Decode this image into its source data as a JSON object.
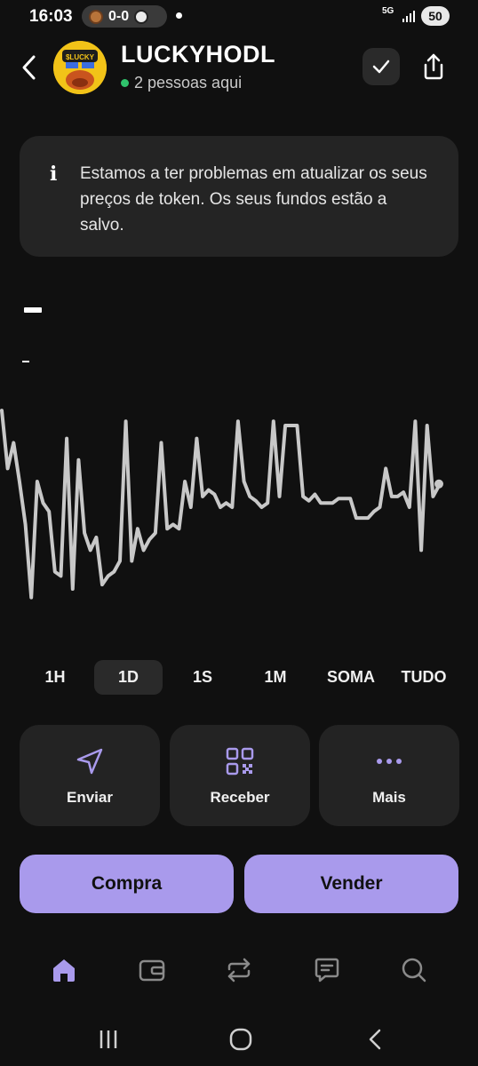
{
  "status_bar": {
    "time": "16:03",
    "score": "0-0",
    "network": "5G",
    "battery": "50"
  },
  "header": {
    "token_name": "LUCKYHODL",
    "presence": "2 pessoas aqui",
    "presence_color": "#2fc36c",
    "avatar_text": "$LUCKY"
  },
  "notice": {
    "icon": "i",
    "text": "Estamos a ter problemas em atualizar os seus preços de token. Os seus fundos estão a salvo."
  },
  "price": {
    "value": "–",
    "change": "-"
  },
  "chart_data": {
    "type": "line",
    "line_color": "#c8c8c8",
    "y": [
      0.95,
      0.68,
      0.8,
      0.62,
      0.42,
      0.08,
      0.62,
      0.52,
      0.48,
      0.2,
      0.18,
      0.82,
      0.12,
      0.72,
      0.38,
      0.3,
      0.36,
      0.14,
      0.18,
      0.2,
      0.25,
      0.9,
      0.25,
      0.4,
      0.3,
      0.35,
      0.38,
      0.8,
      0.4,
      0.42,
      0.4,
      0.62,
      0.5,
      0.82,
      0.55,
      0.58,
      0.56,
      0.5,
      0.52,
      0.5,
      0.9,
      0.62,
      0.55,
      0.53,
      0.5,
      0.52,
      0.9,
      0.55,
      0.88,
      0.88,
      0.88,
      0.55,
      0.53,
      0.56,
      0.52,
      0.52,
      0.52,
      0.54,
      0.54,
      0.54,
      0.45,
      0.45,
      0.45,
      0.48,
      0.5,
      0.68,
      0.55,
      0.55,
      0.57,
      0.5,
      0.9,
      0.3,
      0.88,
      0.55,
      0.6
    ],
    "accent": "#a99aec"
  },
  "time_ranges": {
    "items": [
      "1H",
      "1D",
      "1S",
      "1M",
      "SOMA",
      "TUDO"
    ],
    "selected": "1D"
  },
  "actions": {
    "send": "Enviar",
    "receive": "Receber",
    "more": "Mais"
  },
  "trade": {
    "buy": "Compra",
    "sell": "Vender"
  },
  "bottom_nav": {
    "items": [
      "home-icon",
      "wallet-icon",
      "swap-icon",
      "chat-icon",
      "search-icon"
    ],
    "active": "home-icon"
  }
}
